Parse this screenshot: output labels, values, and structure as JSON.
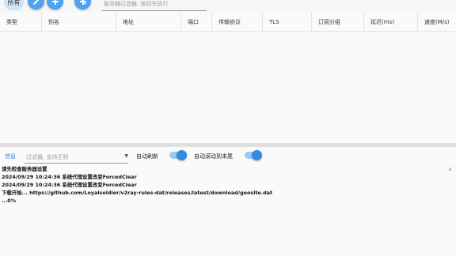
{
  "toolbar": {
    "all_label": "所有",
    "filter_placeholder": "服务器过滤器, 按回车执行"
  },
  "table": {
    "columns": [
      "类型",
      "别名",
      "地址",
      "端口",
      "传输协议",
      "TLS",
      "订阅分组",
      "延迟(ms)",
      "速度(M/s)"
    ]
  },
  "log": {
    "tab_label": "信息",
    "filter_placeholder": "过滤器, 支持正则",
    "auto_refresh_label": "自动刷新",
    "auto_scroll_label": "自动滚动到末尾",
    "auto_refresh_on": true,
    "auto_scroll_on": true,
    "lines": [
      "请先检查服务器设置",
      "2024/09/29 10:24:36 系统代理设置改变ForcedClear",
      "2024/09/29 10:24:36 系统代理设置改变ForcedClear",
      "下载开始...   https://github.com/Loyalsoldier/v2ray-rules-dat/releases/latest/download/geosite.dat",
      "...0%"
    ]
  },
  "colors": {
    "accent": "#4da3ee",
    "toggle_knob": "#2f8ae0",
    "tab_text": "#2c7fd1"
  },
  "icons": [
    "pencil-icon",
    "plus-icon",
    "share-icon",
    "chevron-down-icon",
    "scroll-up-icon"
  ]
}
